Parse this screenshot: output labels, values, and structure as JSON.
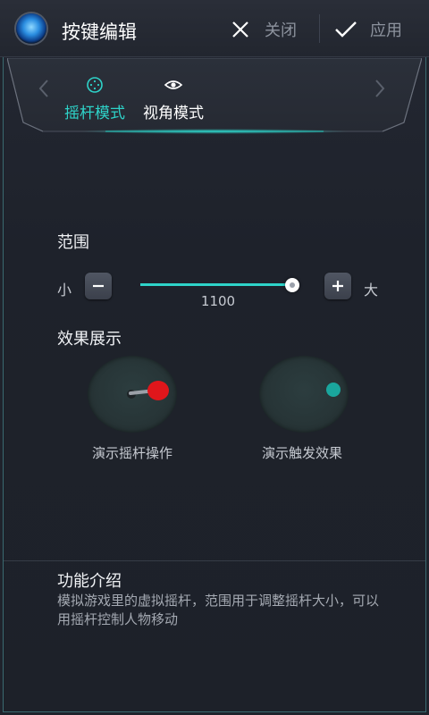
{
  "header": {
    "title": "按键编辑",
    "close_label": "关闭",
    "apply_label": "应用",
    "logo_icon": "app-logo-icon"
  },
  "mode_tabs": [
    {
      "label": "摇杆模式",
      "icon": "joystick-icon",
      "selected": true
    },
    {
      "label": "视角模式",
      "icon": "eye-icon",
      "selected": false
    }
  ],
  "range": {
    "title": "范围",
    "min_label": "小",
    "max_label": "大",
    "value": "1100",
    "fill_fraction": 0.99
  },
  "demo": {
    "title": "效果展示",
    "joystick_label": "演示摇杆操作",
    "touch_label": "演示触发效果"
  },
  "intro": {
    "title": "功能介绍",
    "text": "模拟游戏里的虚拟摇杆，范围用于调整摇杆大小，可以用摇杆控制人物移动"
  },
  "colors": {
    "accent": "#2ed3c9",
    "background": "#1f232c",
    "joystick_knob": "#e0161b"
  }
}
